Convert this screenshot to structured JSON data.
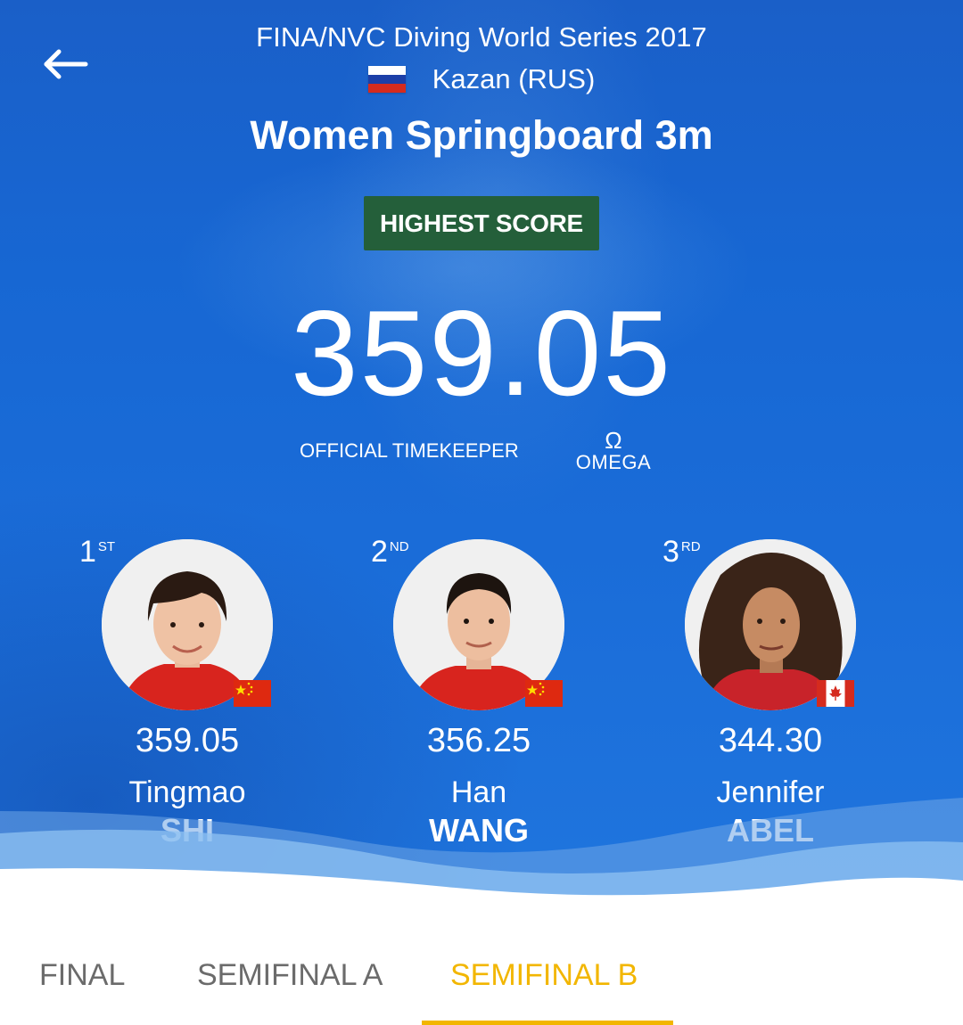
{
  "header": {
    "competition": "FINA/NVC Diving World Series 2017",
    "location": "Kazan (RUS)",
    "event": "Women Springboard 3m",
    "back_icon": "arrow-left-icon"
  },
  "score_panel": {
    "badge": "HIGHEST SCORE",
    "value": "359.05",
    "timekeeper_label": "OFFICIAL TIMEKEEPER",
    "sponsor_symbol": "Ω",
    "sponsor": "OMEGA"
  },
  "podium": [
    {
      "rank": "1",
      "rank_suffix": "ST",
      "score": "359.05",
      "first_name": "Tingmao",
      "last_name": "SHI",
      "country_flag": "china"
    },
    {
      "rank": "2",
      "rank_suffix": "ND",
      "score": "356.25",
      "first_name": "Han",
      "last_name": "WANG",
      "country_flag": "china"
    },
    {
      "rank": "3",
      "rank_suffix": "RD",
      "score": "344.30",
      "first_name": "Jennifer",
      "last_name": "ABEL",
      "country_flag": "canada"
    }
  ],
  "tabs": [
    {
      "label": "FINAL",
      "active": false
    },
    {
      "label": "SEMIFINAL A",
      "active": false
    },
    {
      "label": "SEMIFINAL B",
      "active": true
    }
  ],
  "colors": {
    "background_blue": "#1767d3",
    "badge_green": "#245f3a",
    "active_tab": "#f2b600",
    "inactive_tab": "#6b6b6b"
  }
}
